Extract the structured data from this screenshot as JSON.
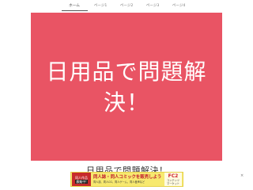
{
  "nav": {
    "tabs": [
      {
        "label": "ホーム",
        "active": true
      },
      {
        "label": "ページ1",
        "active": false
      },
      {
        "label": "ページ2",
        "active": false
      },
      {
        "label": "ページ3",
        "active": false
      },
      {
        "label": "ページ4",
        "active": false
      }
    ]
  },
  "hero": {
    "title": "日用品で問題解決！",
    "background": "#e95464"
  },
  "content": {
    "title": "日用品で問題解決！"
  },
  "ad": {
    "badge_top": "同人作品",
    "badge_bottom": "募集中!",
    "headline": "同人誌・同人コミックを販売しよう",
    "subtext": "同人誌、同人CG、同人ゲーム、同人音声など",
    "logo_main": "FC2",
    "logo_sub1": "コンテンツ",
    "logo_sub2": "マーケット",
    "close_label": "×"
  }
}
